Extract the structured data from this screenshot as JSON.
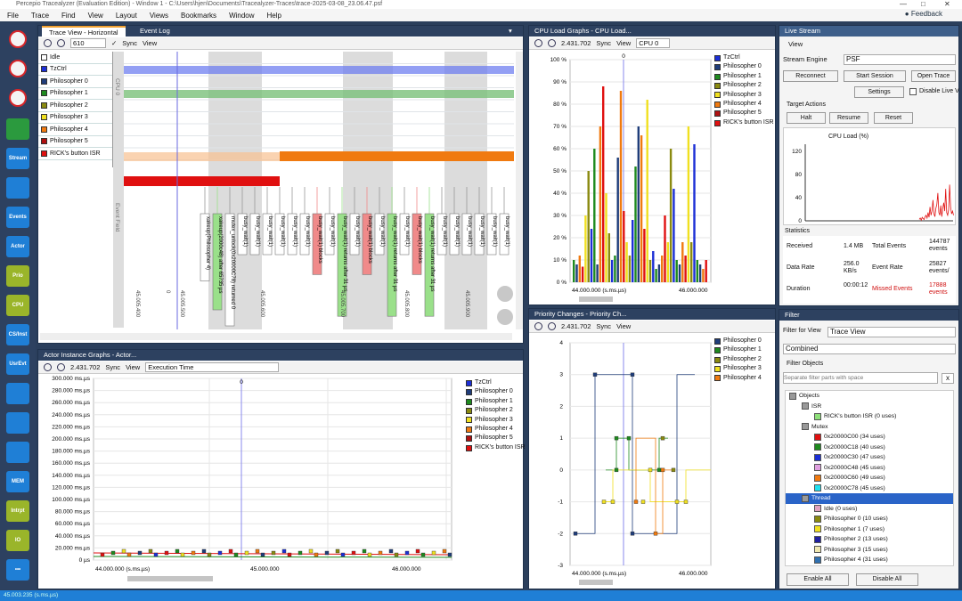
{
  "window": {
    "title": "Percepio Tracealyzer (Evaluation Edition) - Window 1 - C:\\Users\\hjen\\Documents\\Tracealyzer-Traces\\trace-2025-03-08_23.06.47.psf"
  },
  "menu": [
    "File",
    "Trace",
    "Find",
    "View",
    "Layout",
    "Views",
    "Bookmarks",
    "Window",
    "Help"
  ],
  "feedback": "Feedback",
  "toolbar_buttons": [
    {
      "name": "record-icon",
      "label": "",
      "color": "#d9262a"
    },
    {
      "name": "stop-icon",
      "label": "",
      "color": "#d9262a"
    },
    {
      "name": "snapshot-icon",
      "label": "",
      "color": "#d9262a"
    },
    {
      "name": "dashboard-icon",
      "label": "",
      "color": "#2b9a3e"
    },
    {
      "name": "stream-icon",
      "label": "Stream",
      "color": "#1f7fd6"
    },
    {
      "name": "trace-view-icon",
      "label": "",
      "color": "#1f7fd6"
    },
    {
      "name": "events-icon",
      "label": "Events",
      "color": "#1f7fd6"
    },
    {
      "name": "actor-icon",
      "label": "Actor",
      "color": "#1f7fd6"
    },
    {
      "name": "prio-icon",
      "label": "Prio",
      "color": "#9ab52a"
    },
    {
      "name": "cpu-icon",
      "label": "CPU",
      "color": "#9ab52a"
    },
    {
      "name": "csinst-icon",
      "label": "CS/Inst",
      "color": "#1f7fd6"
    },
    {
      "name": "usrevt-icon",
      "label": "UsrEvt",
      "color": "#1f7fd6"
    },
    {
      "name": "diagram-icon",
      "label": "",
      "color": "#1f7fd6"
    },
    {
      "name": "flow-icon",
      "label": "",
      "color": "#1f7fd6"
    },
    {
      "name": "objects-icon",
      "label": "",
      "color": "#1f7fd6"
    },
    {
      "name": "memory-icon",
      "label": "MEM",
      "color": "#1f7fd6"
    },
    {
      "name": "intrpt-icon",
      "label": "Intrpt",
      "color": "#9ab52a"
    },
    {
      "name": "io-icon",
      "label": "IO",
      "color": "#9ab52a"
    },
    {
      "name": "more-icon",
      "label": "•••",
      "color": "#1f7fd6"
    }
  ],
  "trace_view": {
    "tabs": [
      "Trace View - Horizontal",
      "Event Log"
    ],
    "zoom_value": "610",
    "sync": "Sync",
    "view": "View",
    "actors": [
      {
        "name": "Idle",
        "color": "#ffffff"
      },
      {
        "name": "TzCtrl",
        "color": "#1c2fd6"
      },
      {
        "name": "Philosopher 0",
        "color": "#1f3d7a"
      },
      {
        "name": "Philosopher 1",
        "color": "#1e8a1e"
      },
      {
        "name": "Philosopher 2",
        "color": "#8a8a10"
      },
      {
        "name": "Philosopher 3",
        "color": "#f0e020"
      },
      {
        "name": "Philosopher 4",
        "color": "#f07a10"
      },
      {
        "name": "Philosopher 5",
        "color": "#b01010"
      },
      {
        "name": "RICK's button ISR",
        "color": "#e01010"
      }
    ],
    "cpu_label": "CPU 0",
    "event_field_label": "Event Field",
    "events": [
      {
        "text": "xakeup(Philosopher 4)",
        "color": "#ffffff"
      },
      {
        "text": "xakeup(2000c48) after 65735 µs",
        "color": "#9ae08a"
      },
      {
        "text": "mutex_unlock(0x20000C78) returned 0",
        "color": "#ffffff"
      },
      {
        "text": "busy_wait(1)",
        "color": "#ffffff"
      },
      {
        "text": "busy_wait(1)",
        "color": "#ffffff"
      },
      {
        "text": "busy_wait(1)",
        "color": "#ffffff"
      },
      {
        "text": "busy_wait(1)",
        "color": "#ffffff"
      },
      {
        "text": "busy_wait(1)",
        "color": "#ffffff"
      },
      {
        "text": "busy_wait(1)",
        "color": "#ffffff"
      },
      {
        "text": "busy_wait(1) blocks",
        "color": "#f08a8a"
      },
      {
        "text": "busy_wait(1)",
        "color": "#ffffff"
      },
      {
        "text": "busy_wait(1) returns after 31 µs",
        "color": "#9ae08a"
      },
      {
        "text": "busy_wait(1)",
        "color": "#ffffff"
      },
      {
        "text": "busy_wait(1) blocks",
        "color": "#f08a8a"
      },
      {
        "text": "busy_wait(1)",
        "color": "#ffffff"
      },
      {
        "text": "busy_wait(1) returns after 31 µs",
        "color": "#9ae08a"
      },
      {
        "text": "busy_wait(1)",
        "color": "#ffffff"
      },
      {
        "text": "busy_wait(1) blocks",
        "color": "#f08a8a"
      },
      {
        "text": "busy_wait(1) returns after 31 µs",
        "color": "#9ae08a"
      },
      {
        "text": "busy_wait(1)",
        "color": "#ffffff"
      },
      {
        "text": "busy_wait(1)",
        "color": "#ffffff"
      },
      {
        "text": "busy_wait(1)",
        "color": "#ffffff"
      },
      {
        "text": "busy_wait(1)",
        "color": "#ffffff"
      },
      {
        "text": "busy_wait(1)",
        "color": "#ffffff"
      },
      {
        "text": "busy_wait(1)",
        "color": "#ffffff"
      }
    ],
    "time_labels": [
      "45.005.400",
      "0",
      "45.005.500",
      "45.005.600",
      "45.005.700",
      "45.005.800",
      "45.005.900"
    ]
  },
  "actor_graph": {
    "title": "Actor Instance Graphs - Actor...",
    "time": "2.431.702",
    "sync": "Sync",
    "view": "View",
    "metric": "Execution Time",
    "marker": "0",
    "y_ticks": [
      "300.000 ms.µs",
      "280.000 ms.µs",
      "260.000 ms.µs",
      "240.000 ms.µs",
      "220.000 ms.µs",
      "200.000 ms.µs",
      "180.000 ms.µs",
      "160.000 ms.µs",
      "140.000 ms.µs",
      "120.000 ms.µs",
      "100.000 ms.µs",
      "80.000 ms.µs",
      "60.000 ms.µs",
      "40.000 ms.µs",
      "20.000 ms.µs",
      "0 µs"
    ],
    "x_ticks": [
      "44.000.000 (s.ms.µs)",
      "45.000.000",
      "46.000.000"
    ],
    "legend": [
      {
        "name": "TzCtrl",
        "color": "#1c2fd6"
      },
      {
        "name": "Philosopher 0",
        "color": "#1f3d7a"
      },
      {
        "name": "Philosopher 1",
        "color": "#1e8a1e"
      },
      {
        "name": "Philosopher 2",
        "color": "#8a8a10"
      },
      {
        "name": "Philosopher 3",
        "color": "#f0e020"
      },
      {
        "name": "Philosopher 4",
        "color": "#f07a10"
      },
      {
        "name": "Philosopher 5",
        "color": "#b01010"
      },
      {
        "name": "RICK's button ISR",
        "color": "#e01010"
      }
    ]
  },
  "cpu_load": {
    "title": "CPU Load Graphs - CPU Load...",
    "time": "2.431.702",
    "sync": "Sync",
    "view": "View",
    "cpu": "CPU 0",
    "marker": "0",
    "y_ticks": [
      "100 %",
      "90 %",
      "80 %",
      "70 %",
      "60 %",
      "50 %",
      "40 %",
      "30 %",
      "20 %",
      "10 %",
      "0 %"
    ],
    "x_ticks": [
      "44.000.000 (s.ms.µs)",
      "46.000.000"
    ],
    "legend": [
      {
        "name": "TzCtrl",
        "color": "#1c2fd6"
      },
      {
        "name": "Philosopher 0",
        "color": "#1f3d7a"
      },
      {
        "name": "Philosopher 1",
        "color": "#1e8a1e"
      },
      {
        "name": "Philosopher 2",
        "color": "#8a8a10"
      },
      {
        "name": "Philosopher 3",
        "color": "#f0e020"
      },
      {
        "name": "Philosopher 4",
        "color": "#f07a10"
      },
      {
        "name": "Philosopher 5",
        "color": "#b01010"
      },
      {
        "name": "RICK's button ISR",
        "color": "#e01010"
      }
    ]
  },
  "priority": {
    "title": "Priority Changes - Priority Ch...",
    "time": "2.431.702",
    "sync": "Sync",
    "view": "View",
    "y_ticks": [
      "4",
      "3",
      "2",
      "1",
      "0",
      "-1",
      "-2",
      "-3"
    ],
    "x_ticks": [
      "44.000.000 (s.ms.µs)",
      "46.000.000"
    ],
    "legend": [
      {
        "name": "Philosopher 0",
        "color": "#1f3d7a"
      },
      {
        "name": "Philosopher 1",
        "color": "#1e8a1e"
      },
      {
        "name": "Philosopher 2",
        "color": "#8a8a10"
      },
      {
        "name": "Philosopher 3",
        "color": "#f0e020"
      },
      {
        "name": "Philosopher 4",
        "color": "#f07a10"
      }
    ]
  },
  "live_stream": {
    "title": "Live Stream",
    "view": "View",
    "engine_label": "Stream Engine",
    "engine_value": "PSF",
    "reconnect": "Reconnect",
    "start_session": "Start Session",
    "open_trace": "Open Trace",
    "settings": "Settings",
    "disable_live": "Disable Live V",
    "target_actions": "Target Actions",
    "halt": "Halt",
    "resume": "Resume",
    "reset": "Reset",
    "cpu_title": "CPU Load (%)",
    "cpu_y": [
      "120",
      "80",
      "40",
      "0"
    ],
    "statistics": "Statistics",
    "received_label": "Received",
    "received_value": "1.4 MB",
    "total_events_label": "Total Events",
    "total_events_value": "144787 events",
    "data_rate_label": "Data Rate",
    "data_rate_value": "256.0 KB/s",
    "event_rate_label": "Event Rate",
    "event_rate_value": "25827 events/",
    "duration_label": "Duration",
    "duration_value": "00:00:12",
    "missed_label": "Missed Events",
    "missed_value": "17888 events"
  },
  "filter": {
    "title": "Filter",
    "filter_for_view_label": "Filter for View",
    "filter_for_view_value": "Trace View",
    "combined": "Combined",
    "filter_objects": "Filter Objects",
    "search_placeholder": "Separate filter parts with space",
    "tree": [
      {
        "label": "Objects",
        "depth": 0,
        "color": "#999999"
      },
      {
        "label": "ISR",
        "depth": 1,
        "color": "#999999"
      },
      {
        "label": "RICK's button ISR (0 uses)",
        "depth": 2,
        "color": "#8ee07a"
      },
      {
        "label": "Mutex",
        "depth": 1,
        "color": "#999999"
      },
      {
        "label": "0x20000C00 (34 uses)",
        "depth": 2,
        "color": "#e01010"
      },
      {
        "label": "0x20000C18 (40 uses)",
        "depth": 2,
        "color": "#1e8a1e"
      },
      {
        "label": "0x20000C30 (47 uses)",
        "depth": 2,
        "color": "#1c2fd6"
      },
      {
        "label": "0x20000C48 (45 uses)",
        "depth": 2,
        "color": "#e0a0e0"
      },
      {
        "label": "0x20000C60 (49 uses)",
        "depth": 2,
        "color": "#f07a10"
      },
      {
        "label": "0x20000C78 (45 uses)",
        "depth": 2,
        "color": "#20e0f0"
      },
      {
        "label": "Thread",
        "depth": 1,
        "color": "#999999"
      },
      {
        "label": "Idle (0 uses)",
        "depth": 2,
        "color": "#e0a0c0"
      },
      {
        "label": "Philosopher 0 (10 uses)",
        "depth": 2,
        "color": "#8a8a10"
      },
      {
        "label": "Philosopher 1 (7 uses)",
        "depth": 2,
        "color": "#f0e020"
      },
      {
        "label": "Philosopher 2 (13 uses)",
        "depth": 2,
        "color": "#2020a0"
      },
      {
        "label": "Philosopher 3 (15 uses)",
        "depth": 2,
        "color": "#f0e8b0"
      },
      {
        "label": "Philosopher 4 (31 uses)",
        "depth": 2,
        "color": "#3070b0"
      }
    ],
    "enable_all": "Enable All",
    "disable_all": "Disable All"
  },
  "status": {
    "text": "45.003.235 (s.ms.µs)"
  }
}
